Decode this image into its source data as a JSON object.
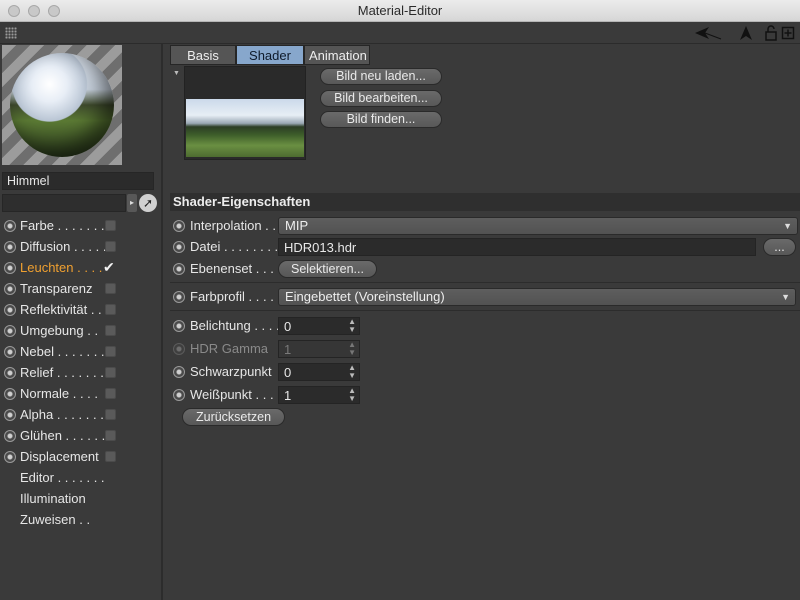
{
  "window": {
    "title": "Material-Editor"
  },
  "toolbar": {
    "icons": [
      "grip-icon",
      "back-arrow-icon",
      "pointer-arrow-icon",
      "lock-icon",
      "new-window-icon"
    ]
  },
  "material": {
    "name": "Himmel",
    "search_value": ""
  },
  "channels": [
    {
      "label": "Farbe",
      "dots": " . . . . . . .",
      "has_check": true,
      "checked": false
    },
    {
      "label": "Diffusion",
      "dots": " . . . . .",
      "has_check": true,
      "checked": false
    },
    {
      "label": "Leuchten",
      "dots": " . . . .",
      "has_check": true,
      "checked": true,
      "active": true
    },
    {
      "label": "Transparenz",
      "dots": "",
      "has_check": true,
      "checked": false
    },
    {
      "label": "Reflektivität",
      "dots": " . .",
      "has_check": true,
      "checked": false
    },
    {
      "label": "Umgebung",
      "dots": " . .",
      "has_check": true,
      "checked": false
    },
    {
      "label": "Nebel",
      "dots": " . . . . . . .",
      "has_check": true,
      "checked": false
    },
    {
      "label": "Relief",
      "dots": " . . . . . . .",
      "has_check": true,
      "checked": false
    },
    {
      "label": "Normale",
      "dots": " . . . .",
      "has_check": true,
      "checked": false
    },
    {
      "label": "Alpha",
      "dots": " . . . . . . .",
      "has_check": true,
      "checked": false
    },
    {
      "label": "Glühen",
      "dots": " . . . . . .",
      "has_check": true,
      "checked": false
    },
    {
      "label": "Displacement",
      "dots": "",
      "has_check": true,
      "checked": false
    },
    {
      "label": "Editor",
      "dots": " . . . . . . .",
      "has_check": false
    },
    {
      "label": "Illumination",
      "dots": "",
      "has_check": false
    },
    {
      "label": "Zuweisen",
      "dots": " . .",
      "has_check": false
    }
  ],
  "tabs": [
    {
      "label": "Basis",
      "active": false
    },
    {
      "label": "Shader",
      "active": true
    },
    {
      "label": "Animation",
      "active": false
    }
  ],
  "image_buttons": {
    "reload": "Bild neu laden...",
    "edit": "Bild bearbeiten...",
    "find": "Bild finden..."
  },
  "section_title": "Shader-Eigenschaften",
  "properties": {
    "interpolation": {
      "label": "Interpolation",
      "dots": " . .",
      "value": "MIP"
    },
    "file": {
      "label": "Datei",
      "dots": " . . . . . . . .",
      "value": "HDR013.hdr",
      "browse": "..."
    },
    "layerset": {
      "label": "Ebenenset",
      "dots": " . . .",
      "button": "Selektieren..."
    },
    "colorprofile": {
      "label": "Farbprofil",
      "dots": " . . . . .",
      "value": "Eingebettet (Voreinstellung)"
    },
    "exposure": {
      "label": "Belichtung",
      "dots": " . . . .",
      "value": "0"
    },
    "hdr_gamma": {
      "label": "HDR Gamma",
      "value": "1"
    },
    "blackpoint": {
      "label": "Schwarzpunkt",
      "value": "0"
    },
    "whitepoint": {
      "label": "Weißpunkt",
      "dots": " . . .",
      "value": "1"
    },
    "reset": "Zurücksetzen"
  },
  "colors": {
    "active_channel": "#f0a030",
    "active_tab": "#87a7cc",
    "panel_bg": "#3a3a3a"
  }
}
